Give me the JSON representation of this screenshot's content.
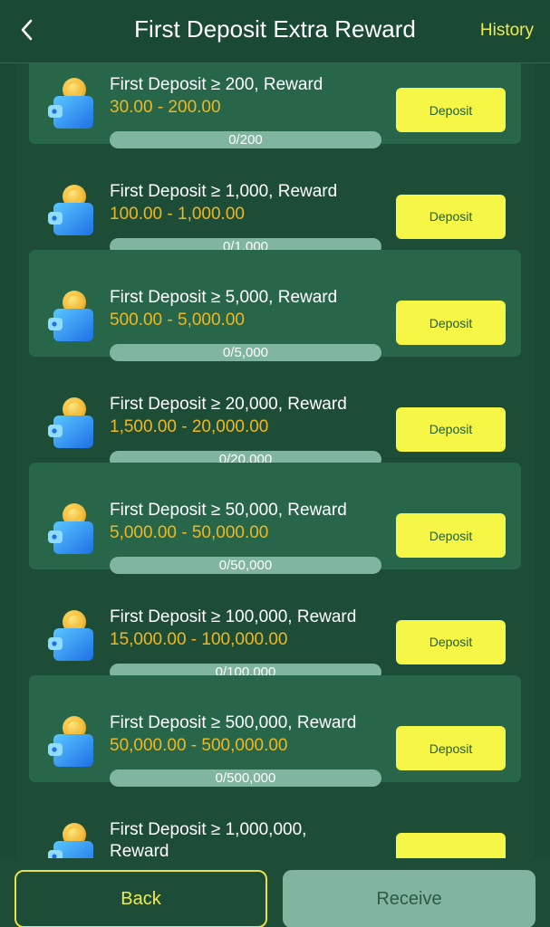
{
  "header": {
    "title": "First Deposit Extra Reward",
    "history_label": "History",
    "back_icon": "chevron-left-icon"
  },
  "tasks": [
    {
      "title": "First Deposit ≥ 200, Reward",
      "range": "30.00 - 200.00",
      "progress_text": "0/200",
      "progress": 0,
      "button_label": "Deposit"
    },
    {
      "title": "First Deposit ≥ 1,000, Reward",
      "range": "100.00 - 1,000.00",
      "progress_text": "0/1,000",
      "progress": 0,
      "button_label": "Deposit"
    },
    {
      "title": "First Deposit ≥ 5,000, Reward",
      "range": "500.00 - 5,000.00",
      "progress_text": "0/5,000",
      "progress": 0,
      "button_label": "Deposit"
    },
    {
      "title": "First Deposit ≥ 20,000, Reward",
      "range": "1,500.00 - 20,000.00",
      "progress_text": "0/20,000",
      "progress": 0,
      "button_label": "Deposit"
    },
    {
      "title": "First Deposit ≥ 50,000, Reward",
      "range": "5,000.00 - 50,000.00",
      "progress_text": "0/50,000",
      "progress": 0,
      "button_label": "Deposit"
    },
    {
      "title": "First Deposit ≥ 100,000, Reward",
      "range": "15,000.00 - 100,000.00",
      "progress_text": "0/100,000",
      "progress": 0,
      "button_label": "Deposit"
    },
    {
      "title": "First Deposit ≥ 500,000, Reward",
      "range": "50,000.00 - 500,000.00",
      "progress_text": "0/500,000",
      "progress": 0,
      "button_label": "Deposit"
    },
    {
      "title": "First Deposit ≥ 1,000,000, Reward",
      "range": "",
      "progress_text": "",
      "progress": 0,
      "button_label": ""
    }
  ],
  "task_icon": "wallet-coin-icon",
  "footer": {
    "back_label": "Back",
    "receive_label": "Receive"
  },
  "colors": {
    "background": "#1b4a34",
    "accent_yellow": "#f6f646",
    "range_gold": "#f0b81f",
    "progress_track": "#80b59f"
  }
}
